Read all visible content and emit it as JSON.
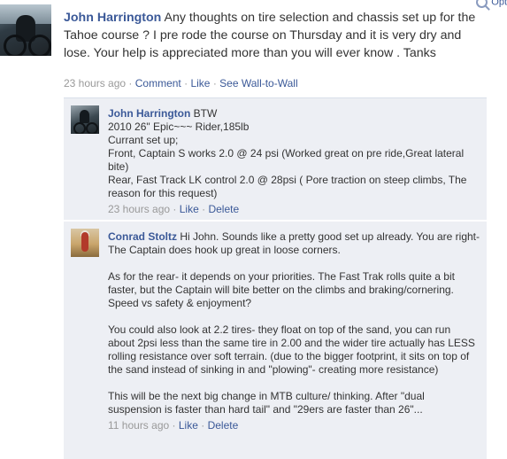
{
  "top_link": "Opt",
  "post": {
    "author": "John Harrington",
    "text": "Any thoughts on tire selection and chassis set up for the Tahoe course ? I pre rode the course on Thursday and it is very dry and lose. Your help is appreciated more than you will ever know . Tanks",
    "time": "23 hours ago",
    "comment_link": "Comment",
    "like_link": "Like",
    "wall_link": "See Wall-to-Wall",
    "sep": "·"
  },
  "comments": [
    {
      "author": "John Harrington",
      "lines": [
        "BTW",
        "2010 26\" Epic~~~ Rider,185lb",
        "Currant set up;",
        "Front, Captain S works 2.0 @ 24 psi (Worked great on pre ride,Great lateral bite)",
        "Rear, Fast Track LK control 2.0 @ 28psi ( Pore traction on steep climbs, The reason for this request)"
      ],
      "time": "23 hours ago",
      "like_link": "Like",
      "delete_link": "Delete"
    },
    {
      "author": "Conrad Stoltz",
      "paragraphs": [
        "Hi John. Sounds like a pretty good set up already. You are right- The Captain does hook up great in loose corners.",
        "As for the rear- it depends on your priorities. The Fast Trak rolls quite a bit faster, but the Captain will bite better on the climbs and braking/cornering. Speed vs safety & enjoyment?",
        "You could also look at 2.2 tires- they float on top of the sand, you can run about 2psi less than the same tire in 2.00 and the wider tire actually has LESS rolling resistance over soft terrain. (due to the bigger footprint, it sits on top of the sand instead of sinking in and \"plowing\"- creating more resistance)",
        "This will be the next big change in MTB culture/ thinking. After \"dual suspension is faster than hard tail\" and \"29ers are faster than 26\"..."
      ],
      "time": "11 hours ago",
      "like_link": "Like",
      "delete_link": "Delete"
    }
  ]
}
